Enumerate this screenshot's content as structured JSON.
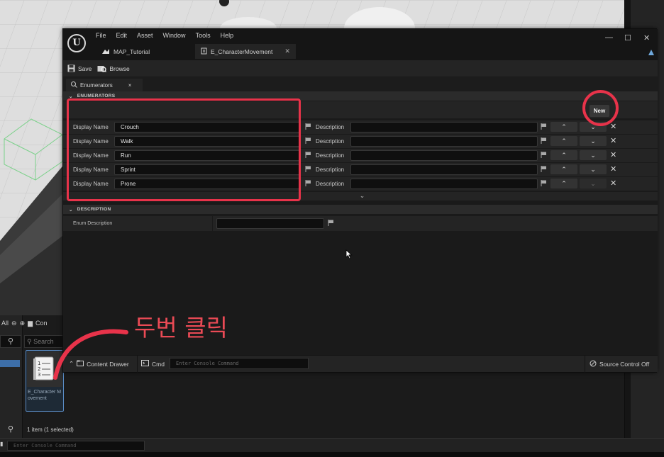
{
  "annotation": {
    "text": "두번 클릭"
  },
  "content_browser": {
    "top_all": "All",
    "top_breadcrumb": "Con",
    "search_placeholder": "Search",
    "asset_label": "E_Character Movement",
    "item_count": "1 item (1 selected)",
    "console_placeholder": "Enter Console Command"
  },
  "window": {
    "logo": "U",
    "menu": [
      "File",
      "Edit",
      "Asset",
      "Window",
      "Tools",
      "Help"
    ],
    "controls": {
      "minimize": "—",
      "maximize": "☐",
      "close": "✕"
    },
    "tabs": [
      {
        "label": "MAP_Tutorial"
      },
      {
        "label": "E_CharacterMovement",
        "close": "✕"
      }
    ],
    "toolbar": {
      "save": "Save",
      "browse": "Browse"
    },
    "panel_tab": {
      "label": "Enumerators",
      "close": "×"
    },
    "enumerators_header": "ENUMERATORS",
    "new_button": "New",
    "enumerators": [
      {
        "display_name_label": "Display Name",
        "value": "Crouch",
        "description_label": "Description",
        "up_enabled": true,
        "down_enabled": true
      },
      {
        "display_name_label": "Display Name",
        "value": "Walk",
        "description_label": "Description",
        "up_enabled": true,
        "down_enabled": true
      },
      {
        "display_name_label": "Display Name",
        "value": "Run",
        "description_label": "Description",
        "up_enabled": true,
        "down_enabled": true
      },
      {
        "display_name_label": "Display Name",
        "value": "Sprint",
        "description_label": "Description",
        "up_enabled": true,
        "down_enabled": true
      },
      {
        "display_name_label": "Display Name",
        "value": "Prone",
        "description_label": "Description",
        "up_enabled": true,
        "down_enabled": false
      }
    ],
    "description_header": "DESCRIPTION",
    "enum_description_label": "Enum Description",
    "statusbar": {
      "content_drawer": "Content Drawer",
      "cmd": "Cmd",
      "console_placeholder": "Enter Console Command",
      "source_control": "Source Control Off"
    }
  },
  "colors": {
    "annotation_red": "#e8334a",
    "selection_blue": "#3d6ea8"
  }
}
